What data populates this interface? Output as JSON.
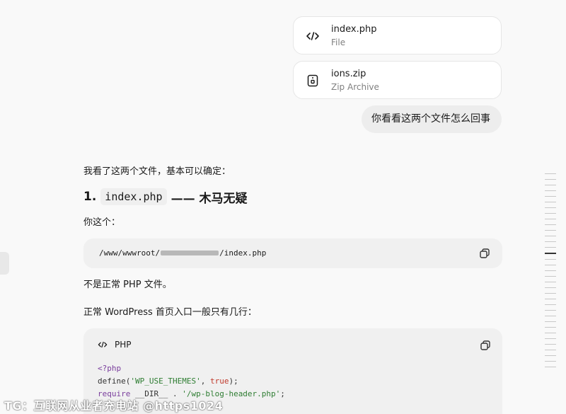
{
  "attachments": [
    {
      "name": "index.php",
      "type": "File",
      "icon": "code-icon"
    },
    {
      "name": "ions.zip",
      "type": "Zip Archive",
      "icon": "archive-icon"
    }
  ],
  "user_message": "你看看这两个文件怎么回事",
  "answer": {
    "intro": "我看了这两个文件，基本可以确定：",
    "heading_number": "1.",
    "heading_code": "index.php",
    "heading_suffix": "—— 木马无疑",
    "yours_label": "你这个：",
    "path_prefix": "/www/wwwroot/",
    "path_suffix": "/index.php",
    "not_normal": "不是正常 PHP 文件。",
    "normal_desc": "正常 WordPress 首页入口一般只有几行：",
    "code_lang": "PHP",
    "code": {
      "line1": "<?php",
      "line2_fn": "define(",
      "line2_str": "'WP_USE_THEMES'",
      "line2_sep": ", ",
      "line2_lit": "true",
      "line2_end": ");",
      "line3_kw": "require",
      "line3_mid": " __DIR__ . ",
      "line3_str": "'/wp-blog-header.php'",
      "line3_end": ";"
    }
  },
  "watermark": "TG：互联网从业者充电站 @https1024"
}
